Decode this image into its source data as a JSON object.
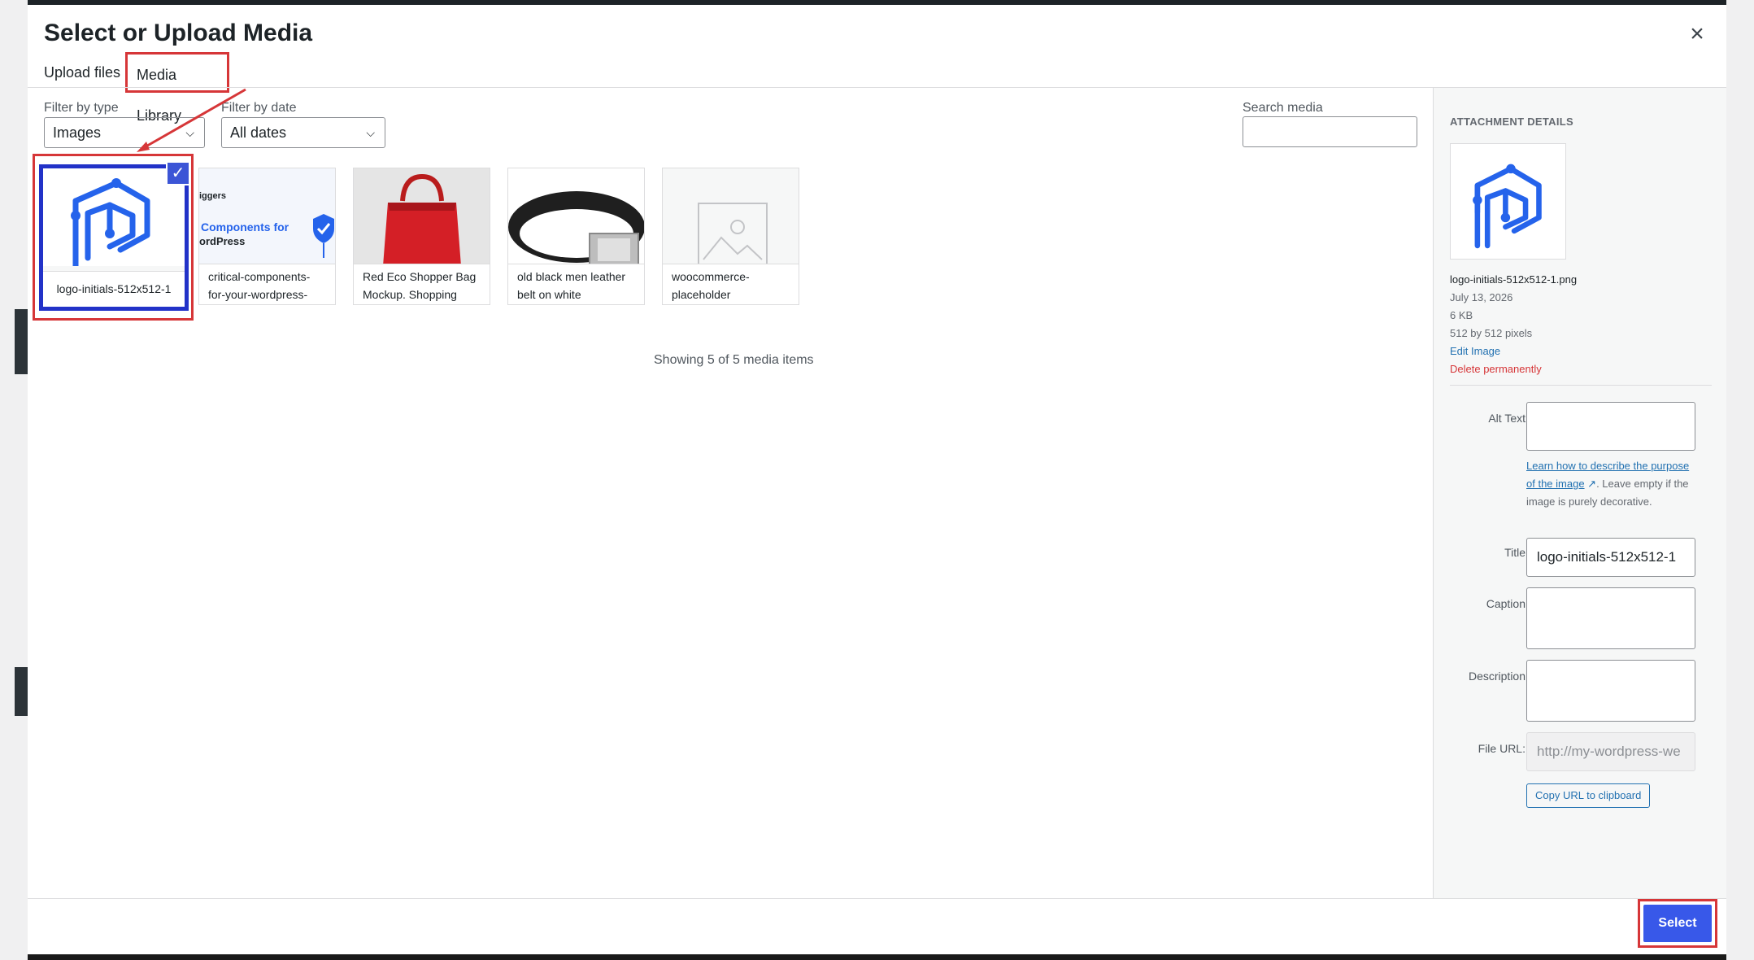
{
  "modal": {
    "title": "Select or Upload Media",
    "close_icon": "×"
  },
  "tabs": [
    {
      "label": "Upload files"
    },
    {
      "label": "Media Library"
    }
  ],
  "filters": {
    "type_label": "Filter by type",
    "type_value": "Images",
    "date_label": "Filter by date",
    "date_value": "All dates",
    "search_label": "Search media",
    "search_placeholder": ""
  },
  "media": [
    {
      "caption": "logo-initials-512x512-1",
      "icon": "logo-initials-image",
      "selected": true
    },
    {
      "caption": "critical-components-for-your-wordpress-",
      "preview_lines": [
        "iggers",
        "Components for",
        "ordPress"
      ],
      "icon": "blog-graphic-image"
    },
    {
      "caption": "Red Eco Shopper Bag Mockup. Shopping",
      "icon": "red-bag-image"
    },
    {
      "caption": "old black men leather belt on white",
      "icon": "belt-image"
    },
    {
      "caption": "woocommerce-placeholder",
      "icon": "placeholder-image"
    }
  ],
  "showing_text": "Showing 5 of 5 media items",
  "attachment": {
    "heading": "ATTACHMENT DETAILS",
    "filename": "logo-initials-512x512-1.png",
    "date": "July 13, 2026",
    "size": "6 KB",
    "dimensions": "512 by 512 pixels",
    "edit_link": "Edit Image",
    "delete_link": "Delete permanently",
    "alt_label": "Alt Text",
    "alt_value": "",
    "help_link": "Learn how to describe the purpose of the image",
    "help_text": ". Leave empty if the image is purely decorative.",
    "title_label": "Title",
    "title_value": "logo-initials-512x512-1",
    "caption_label": "Caption",
    "caption_value": "",
    "description_label": "Description",
    "description_value": "",
    "url_label": "File URL:",
    "url_value": "http://my-wordpress-we",
    "copy_button": "Copy URL to clipboard"
  },
  "footer": {
    "select_button": "Select"
  },
  "colors": {
    "accent": "#3858e9",
    "annotation": "#d63638",
    "logo": "#2563eb"
  }
}
